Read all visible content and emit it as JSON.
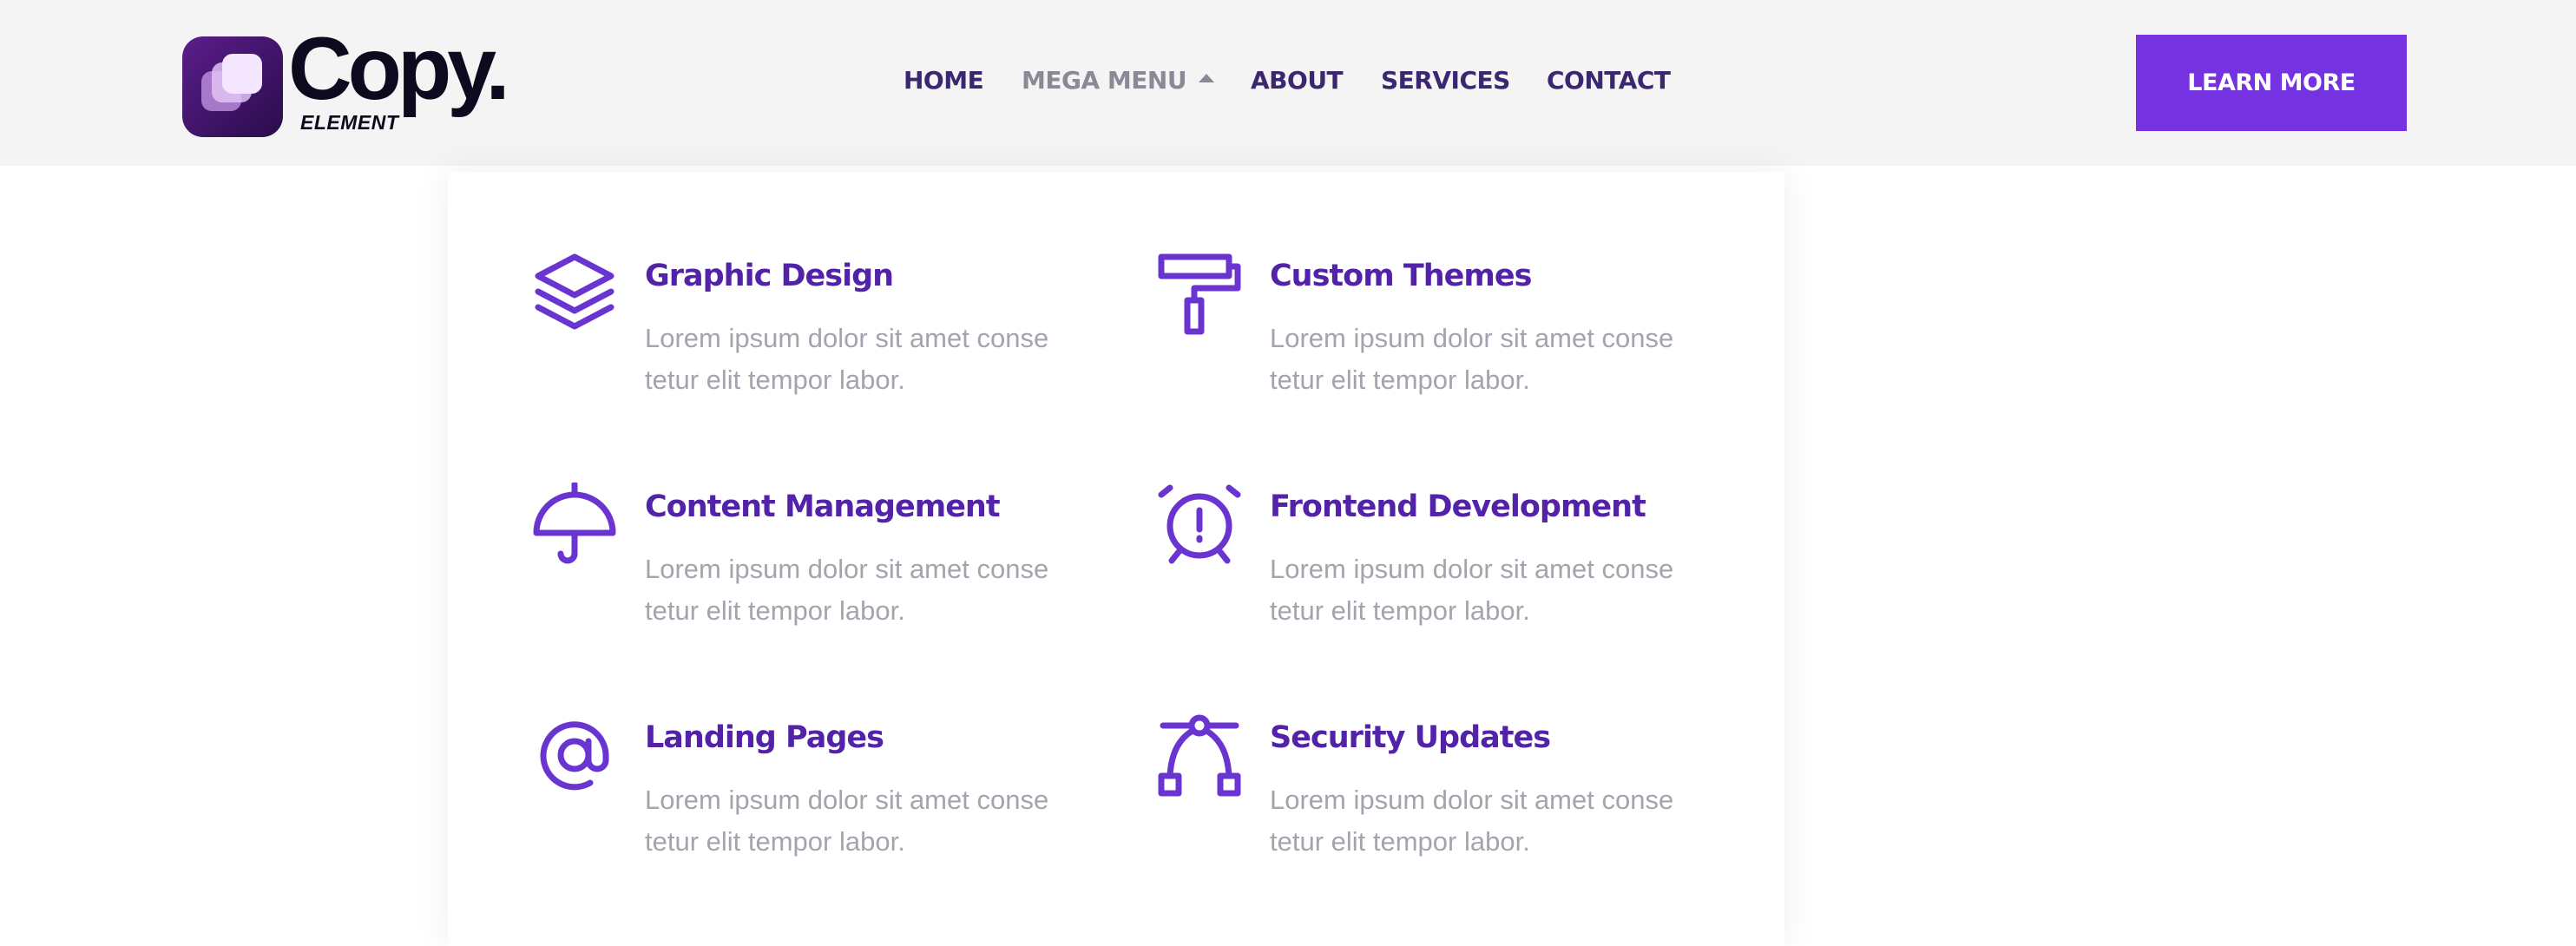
{
  "brand": {
    "name": "Copy.",
    "tagline": "ELEMENT",
    "accent_color": "#7432e0",
    "icon_color": "#6a34d0",
    "title_color": "#5223a8"
  },
  "nav": {
    "items": [
      {
        "label": "HOME",
        "active": false
      },
      {
        "label": "MEGA MENU",
        "active": true,
        "icon": "caret-up-icon"
      },
      {
        "label": "ABOUT",
        "active": false
      },
      {
        "label": "SERVICES",
        "active": false
      },
      {
        "label": "CONTACT",
        "active": false
      }
    ]
  },
  "cta": {
    "label": "LEARN MORE"
  },
  "mega_menu": {
    "features": [
      {
        "title": "Graphic Design",
        "description": "Lorem ipsum dolor sit amet conse tetur elit tempor labor.",
        "icon": "layers-icon"
      },
      {
        "title": "Custom Themes",
        "description": "Lorem ipsum dolor sit amet conse tetur elit tempor labor.",
        "icon": "paint-roller-icon"
      },
      {
        "title": "Content Management",
        "description": "Lorem ipsum dolor sit amet conse tetur elit tempor labor.",
        "icon": "umbrella-icon"
      },
      {
        "title": "Frontend Development",
        "description": "Lorem ipsum dolor sit amet conse tetur elit tempor labor.",
        "icon": "alarm-clock-icon"
      },
      {
        "title": "Landing Pages",
        "description": "Lorem ipsum dolor sit amet conse tetur elit tempor labor.",
        "icon": "at-sign-icon"
      },
      {
        "title": "Security Updates",
        "description": "Lorem ipsum dolor sit amet conse tetur elit tempor labor.",
        "icon": "bezier-curve-icon"
      }
    ]
  }
}
